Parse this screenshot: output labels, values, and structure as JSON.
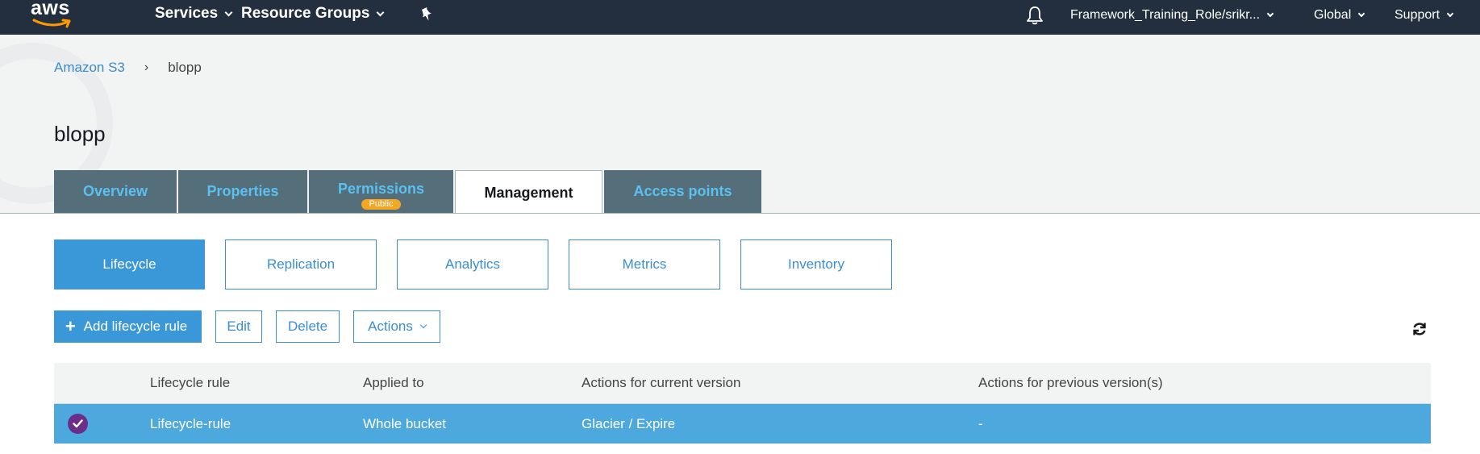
{
  "topnav": {
    "logo_text": "aws",
    "services_label": "Services",
    "resource_groups_label": "Resource Groups",
    "account_label": "Framework_Training_Role/srikr...",
    "region_label": "Global",
    "support_label": "Support"
  },
  "breadcrumb": {
    "root": "Amazon S3",
    "separator": "›",
    "current": "blopp"
  },
  "page": {
    "title": "blopp"
  },
  "tabs": [
    {
      "label": "Overview"
    },
    {
      "label": "Properties"
    },
    {
      "label": "Permissions",
      "badge": "Public"
    },
    {
      "label": "Management"
    },
    {
      "label": "Access points"
    }
  ],
  "subtabs": [
    {
      "label": "Lifecycle"
    },
    {
      "label": "Replication"
    },
    {
      "label": "Analytics"
    },
    {
      "label": "Metrics"
    },
    {
      "label": "Inventory"
    }
  ],
  "toolbar": {
    "add_label": "Add lifecycle rule",
    "edit_label": "Edit",
    "delete_label": "Delete",
    "actions_label": "Actions"
  },
  "table": {
    "headers": [
      "Lifecycle rule",
      "Applied to",
      "Actions for current version",
      "Actions for previous version(s)"
    ],
    "rows": [
      {
        "rule": "Lifecycle-rule",
        "applied_to": "Whole bucket",
        "current": "Glacier / Expire",
        "previous": "-"
      }
    ]
  },
  "colors": {
    "nav_bg": "#232f3e",
    "accent": "#3a98d8",
    "tab_bg": "#546e7a",
    "tab_text": "#5bc0f0",
    "badge": "#f5a623",
    "selected_row": "#4ca8dd",
    "check": "#6a2e8a"
  }
}
